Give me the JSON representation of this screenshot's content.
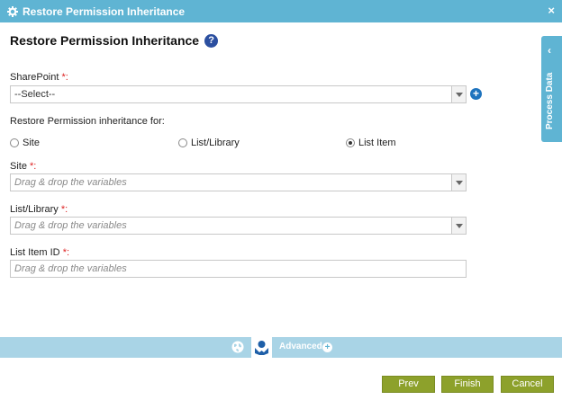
{
  "window": {
    "title": "Restore Permission Inheritance",
    "close_label": "×"
  },
  "heading": {
    "title": "Restore Permission Inheritance",
    "help_label": "?"
  },
  "sharepoint": {
    "label": "SharePoint",
    "required_mark": "*:",
    "selected": "--Select--",
    "add_label": "+"
  },
  "restore_for": {
    "label": "Restore Permission inheritance for:",
    "options": [
      {
        "label": "Site",
        "checked": false
      },
      {
        "label": "List/Library",
        "checked": false
      },
      {
        "label": "List Item",
        "checked": true
      }
    ]
  },
  "site": {
    "label": "Site",
    "required_mark": "*:",
    "placeholder": "Drag & drop the variables"
  },
  "list_library": {
    "label": "List/Library",
    "required_mark": "*:",
    "placeholder": "Drag & drop the variables"
  },
  "list_item_id": {
    "label": "List Item ID",
    "required_mark": "*:",
    "placeholder": "Drag & drop the variables"
  },
  "side_panel": {
    "label": "Process Data",
    "chevron": "‹"
  },
  "bottom_toolbar": {
    "advanced_label": "Advanced",
    "plus_label": "+"
  },
  "buttons": {
    "prev": "Prev",
    "finish": "Finish",
    "cancel": "Cancel"
  },
  "colors": {
    "titlebar": "#5fb4d3",
    "toolbar": "#a9d4e6",
    "button": "#8da12b",
    "required": "#dd2222"
  }
}
